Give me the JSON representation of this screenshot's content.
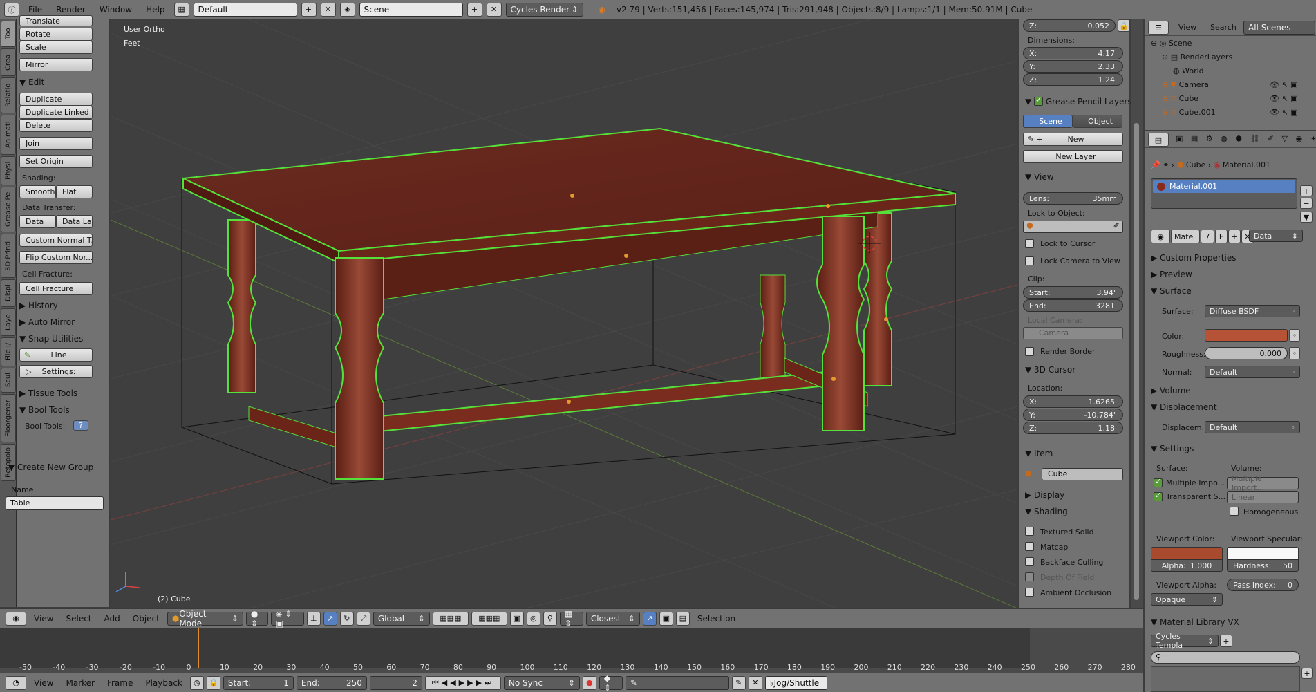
{
  "topbar": {
    "menus": [
      "File",
      "Render",
      "Window",
      "Help"
    ],
    "layout": "Default",
    "scene": "Scene",
    "engine": "Cycles Render",
    "stats": "v2.79 | Verts:151,456 | Faces:145,974 | Tris:291,948 | Objects:8/9 | Lamps:1/1 | Mem:50.91M | Cube"
  },
  "lefttabs": [
    "Too",
    "Crea",
    "Relatio",
    "Animati",
    "Physi",
    "Grease Pe",
    "3D Printi",
    "Displ",
    "Laye",
    "File I/",
    "Scul",
    "Floorgener",
    "Retopolo"
  ],
  "toolshelf": {
    "translate": "Translate",
    "rotate": "Rotate",
    "scale": "Scale",
    "mirror": "Mirror",
    "edit_header": "Edit",
    "duplicate": "Duplicate",
    "duplicate_linked": "Duplicate Linked",
    "delete": "Delete",
    "join": "Join",
    "set_origin": "Set Origin",
    "shading_label": "Shading:",
    "smooth": "Smooth",
    "flat": "Flat",
    "data_transfer_label": "Data Transfer:",
    "data": "Data",
    "data_la": "Data La",
    "custom_normal": "Custom Normal T...",
    "flip_custom": "Flip Custom Nor...",
    "cell_fracture_label": "Cell Fracture:",
    "cell_fracture": "Cell Fracture",
    "history": "History",
    "auto_mirror": "Auto Mirror",
    "snap_utilities": "Snap Utilities",
    "line": "Line",
    "settings": "Settings:",
    "tissue_tools": "Tissue Tools",
    "bool_tools": "Bool Tools",
    "bool_tools_label": "Bool Tools:",
    "create_group": "Create New Group",
    "name_label": "Name",
    "name_value": "Table"
  },
  "viewport": {
    "view_name": "User Ortho",
    "units": "Feet",
    "object_label": "(2) Cube"
  },
  "npanel": {
    "loc_z": "0.052",
    "dimensions_label": "Dimensions:",
    "dim_x": "4.17'",
    "dim_y": "2.33'",
    "dim_z": "1.24'",
    "grease_layers": "Grease Pencil Layers",
    "gp_scene": "Scene",
    "gp_object": "Object",
    "gp_new": "New",
    "gp_new_layer": "New Layer",
    "view_header": "View",
    "lens_label": "Lens:",
    "lens_value": "35mm",
    "lock_object_label": "Lock to Object:",
    "lock_cursor": "Lock to Cursor",
    "lock_camera": "Lock Camera to View",
    "clip_label": "Clip:",
    "clip_start_label": "Start:",
    "clip_start": "3.94\"",
    "clip_end_label": "End:",
    "clip_end": "3281'",
    "local_camera_label": "Local Camera:",
    "local_camera": "Camera",
    "render_border": "Render Border",
    "cursor_header": "3D Cursor",
    "location_label": "Location:",
    "cur_x": "1.6265'",
    "cur_y": "-10.784\"",
    "cur_z": "1.18'",
    "item_header": "Item",
    "item_name": "Cube",
    "display_header": "Display",
    "shading_header": "Shading",
    "textured_solid": "Textured Solid",
    "matcap": "Matcap",
    "backface": "Backface Culling",
    "depth_field": "Depth Of Field",
    "ambient": "Ambient Occlusion"
  },
  "outliner": {
    "menus": [
      "View",
      "Search"
    ],
    "filter": "All Scenes",
    "items": [
      "Scene",
      "RenderLayers",
      "World",
      "Camera",
      "Cube",
      "Cube.001"
    ]
  },
  "props": {
    "breadcrumb_obj": "Cube",
    "breadcrumb_mat": "Material.001",
    "slot": "Material.001",
    "mat_name": "Mate",
    "mat_users": "7",
    "mat_f": "F",
    "link": "Data",
    "custom_props": "Custom Properties",
    "preview": "Preview",
    "surface_header": "Surface",
    "surface_label": "Surface:",
    "surface_value": "Diffuse BSDF",
    "color_label": "Color:",
    "roughness_label": "Roughness:",
    "roughness_value": "0.000",
    "normal_label": "Normal:",
    "normal_value": "Default",
    "volume_header": "Volume",
    "displacement_header": "Displacement",
    "displacement_label": "Displacem...",
    "displacement_value": "Default",
    "settings_header": "Settings",
    "surface_sub": "Surface:",
    "volume_sub": "Volume:",
    "multiple_importance": "Multiple Impo...",
    "vol_multiple": "Multiple Import...",
    "transparent": "Transparent S...",
    "vol_linear": "Linear",
    "homogeneous": "Homogeneous",
    "viewport_color": "Viewport Color:",
    "viewport_specular": "Viewport Specular:",
    "alpha_label": "Alpha:",
    "alpha_value": "1.000",
    "hardness_label": "Hardness:",
    "hardness_value": "50",
    "viewport_alpha": "Viewport Alpha:",
    "pass_index_label": "Pass Index:",
    "pass_index_value": "0",
    "opaque": "Opaque",
    "material_library": "Material Library VX",
    "cycles_template": "Cycles Templa"
  },
  "viewhdr": {
    "menus": [
      "View",
      "Select",
      "Add",
      "Object"
    ],
    "mode": "Object Mode",
    "orientation": "Global",
    "snap": "Closest",
    "selection": "Selection"
  },
  "timeline": {
    "ticks": [
      "-50",
      "-40",
      "-30",
      "-20",
      "-10",
      "0",
      "10",
      "20",
      "30",
      "40",
      "50",
      "60",
      "70",
      "80",
      "90",
      "100",
      "110",
      "120",
      "130",
      "140",
      "150",
      "160",
      "170",
      "180",
      "190",
      "200",
      "210",
      "220",
      "230",
      "240",
      "250",
      "260",
      "270",
      "280"
    ]
  },
  "timehdr": {
    "menus": [
      "View",
      "Marker",
      "Frame",
      "Playback"
    ],
    "start_label": "Start:",
    "start_value": "1",
    "end_label": "End:",
    "end_value": "250",
    "current": "2",
    "sync": "No Sync",
    "keying": "Jog/Shuttle"
  },
  "colors": {
    "material_color": "#b65236",
    "viewport_color": "#a84a2e",
    "wood": "#7a2a1c",
    "selection_outline": "#55e03a",
    "active_blue": "#5680c2"
  }
}
